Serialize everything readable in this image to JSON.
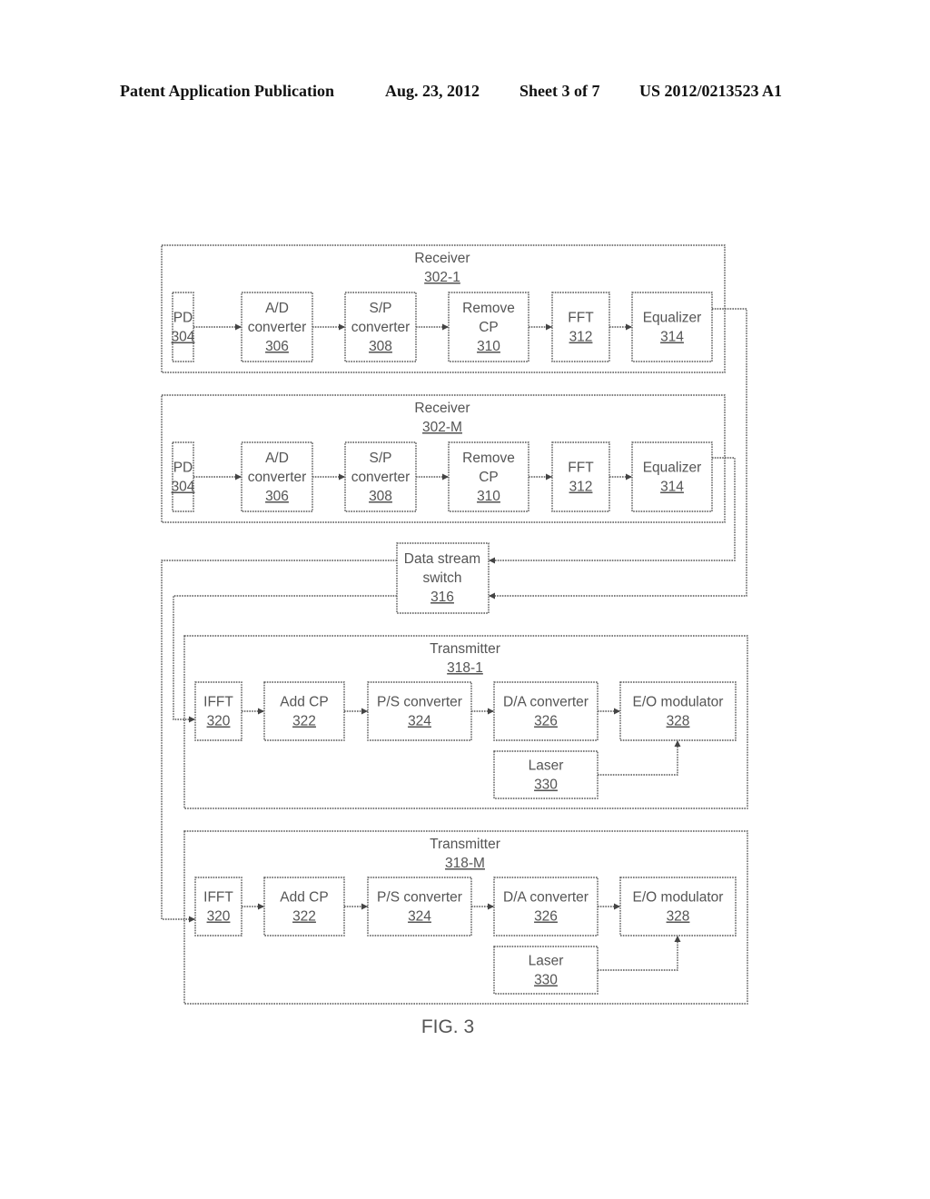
{
  "header": {
    "left": "Patent Application Publication",
    "date": "Aug. 23, 2012",
    "sheet": "Sheet 3 of 7",
    "number": "US 2012/0213523 A1"
  },
  "figure_label": "FIG. 3",
  "receivers": [
    {
      "title": "Receiver",
      "ref": "302-1",
      "blocks": [
        {
          "lines": [
            "PD"
          ],
          "ref": "304"
        },
        {
          "lines": [
            "A/D",
            "converter"
          ],
          "ref": "306"
        },
        {
          "lines": [
            "S/P",
            "converter"
          ],
          "ref": "308"
        },
        {
          "lines": [
            "Remove",
            "CP"
          ],
          "ref": "310"
        },
        {
          "lines": [
            "FFT"
          ],
          "ref": "312"
        },
        {
          "lines": [
            "Equalizer"
          ],
          "ref": "314"
        }
      ]
    },
    {
      "title": "Receiver",
      "ref": "302-M",
      "blocks": [
        {
          "lines": [
            "PD"
          ],
          "ref": "304"
        },
        {
          "lines": [
            "A/D",
            "converter"
          ],
          "ref": "306"
        },
        {
          "lines": [
            "S/P",
            "converter"
          ],
          "ref": "308"
        },
        {
          "lines": [
            "Remove",
            "CP"
          ],
          "ref": "310"
        },
        {
          "lines": [
            "FFT"
          ],
          "ref": "312"
        },
        {
          "lines": [
            "Equalizer"
          ],
          "ref": "314"
        }
      ]
    }
  ],
  "switch": {
    "lines": [
      "Data stream",
      "switch"
    ],
    "ref": "316"
  },
  "transmitters": [
    {
      "title": "Transmitter",
      "ref": "318-1",
      "blocks": [
        {
          "lines": [
            "IFFT"
          ],
          "ref": "320"
        },
        {
          "lines": [
            "Add CP"
          ],
          "ref": "322"
        },
        {
          "lines": [
            "P/S converter"
          ],
          "ref": "324"
        },
        {
          "lines": [
            "D/A converter"
          ],
          "ref": "326"
        },
        {
          "lines": [
            "E/O modulator"
          ],
          "ref": "328"
        }
      ],
      "laser": {
        "lines": [
          "Laser"
        ],
        "ref": "330"
      }
    },
    {
      "title": "Transmitter",
      "ref": "318-M",
      "blocks": [
        {
          "lines": [
            "IFFT"
          ],
          "ref": "320"
        },
        {
          "lines": [
            "Add CP"
          ],
          "ref": "322"
        },
        {
          "lines": [
            "P/S converter"
          ],
          "ref": "324"
        },
        {
          "lines": [
            "D/A converter"
          ],
          "ref": "326"
        },
        {
          "lines": [
            "E/O modulator"
          ],
          "ref": "328"
        }
      ],
      "laser": {
        "lines": [
          "Laser"
        ],
        "ref": "330"
      }
    }
  ]
}
